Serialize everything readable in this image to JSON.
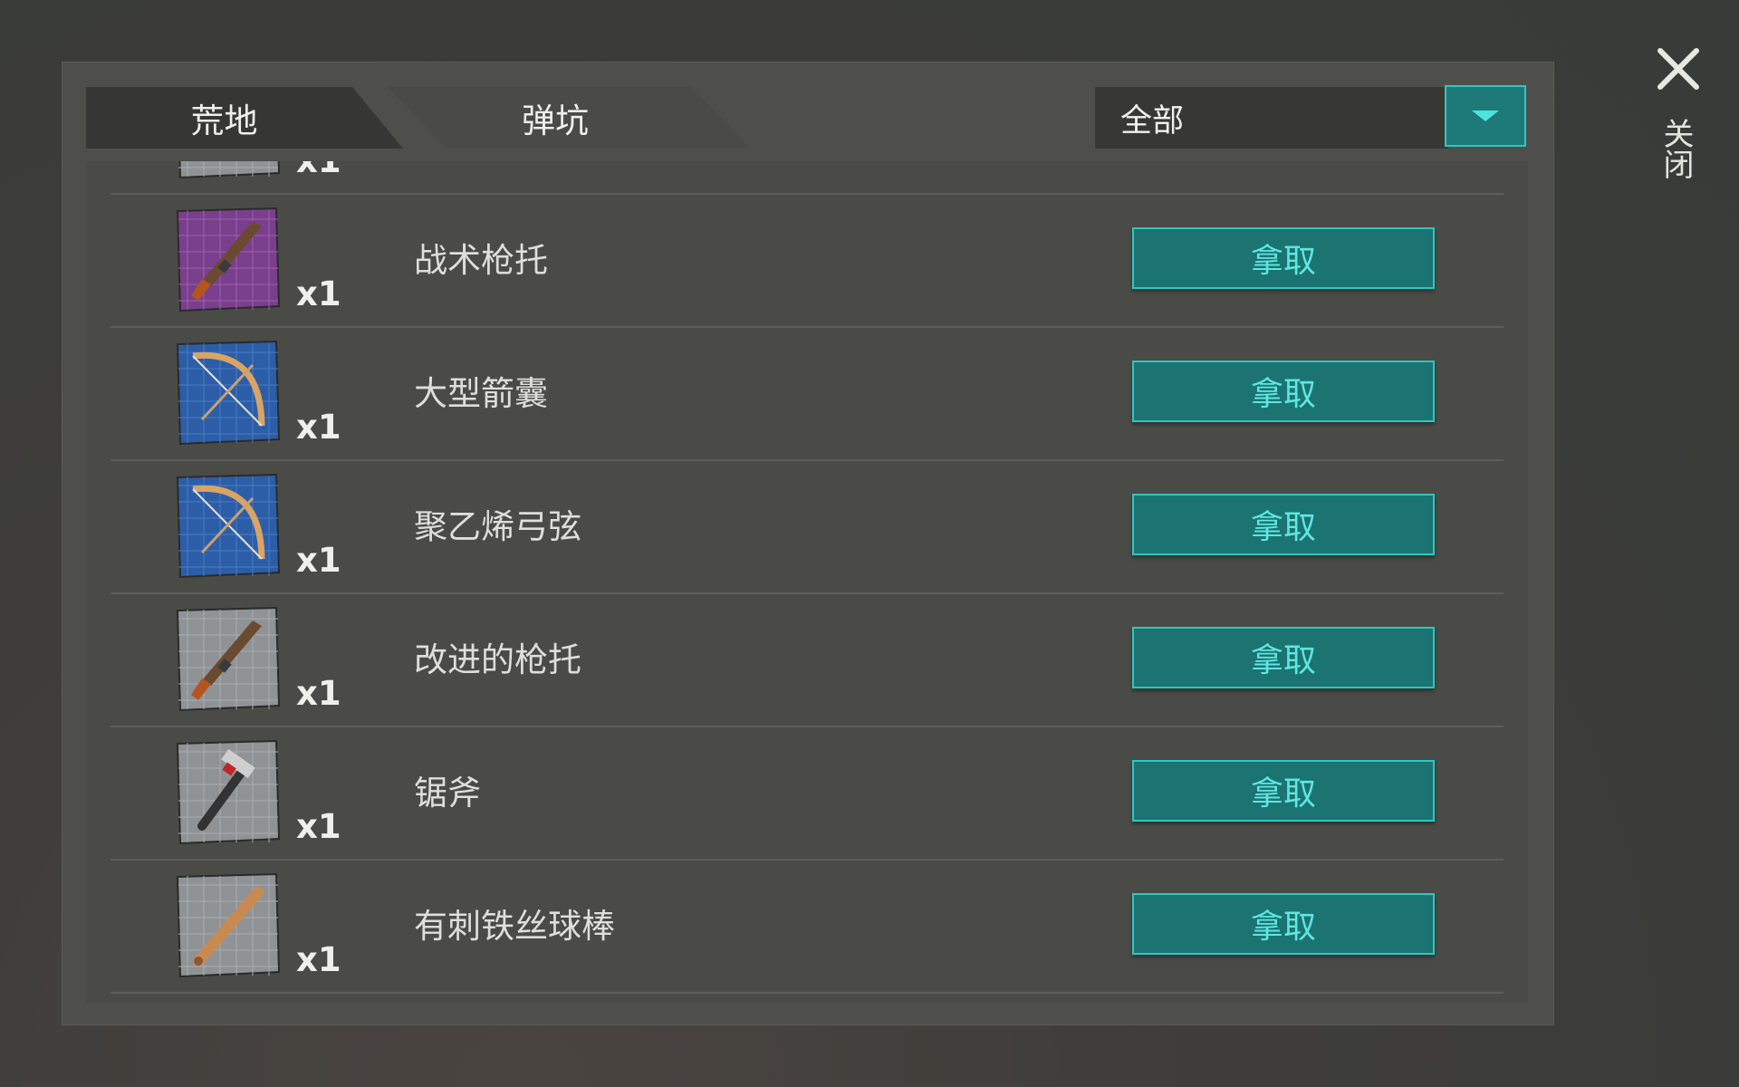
{
  "tabs": [
    {
      "label": "荒地"
    },
    {
      "label": "弹坑"
    }
  ],
  "filter": {
    "selected": "全部"
  },
  "close": {
    "label": "关闭"
  },
  "items": [
    {
      "quantity": "x1",
      "name": "",
      "icon": "blueprint-partial-icon",
      "tier": "gray"
    },
    {
      "quantity": "x1",
      "name": "战术枪托",
      "icon": "shotgun-blueprint-icon",
      "tier": "purple",
      "take_label": "拿取"
    },
    {
      "quantity": "x1",
      "name": "大型箭囊",
      "icon": "bow-blueprint-icon",
      "tier": "blue",
      "take_label": "拿取"
    },
    {
      "quantity": "x1",
      "name": "聚乙烯弓弦",
      "icon": "bow-blueprint-icon",
      "tier": "blue",
      "take_label": "拿取"
    },
    {
      "quantity": "x1",
      "name": "改进的枪托",
      "icon": "shotgun-blueprint-icon",
      "tier": "gray",
      "take_label": "拿取"
    },
    {
      "quantity": "x1",
      "name": "锯斧",
      "icon": "hammer-blueprint-icon",
      "tier": "gray",
      "take_label": "拿取"
    },
    {
      "quantity": "x1",
      "name": "有刺铁丝球棒",
      "icon": "bat-blueprint-icon",
      "tier": "gray",
      "take_label": "拿取"
    }
  ],
  "colors": {
    "accent": "#1b7372",
    "accent_border": "#2fc6c0",
    "tier_purple": "#7a3f8c",
    "tier_blue": "#2c5ea8",
    "tier_gray": "#8f9396"
  }
}
